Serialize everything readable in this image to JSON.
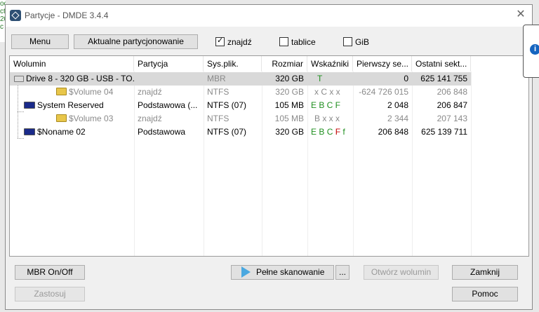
{
  "window": {
    "title": "Partycje - DMDE 3.4.4",
    "close_glyph": "✕"
  },
  "toolbar": {
    "menu": "Menu",
    "partitioning": "Aktualne partycjonowanie",
    "found": {
      "label": "znajdź",
      "checked": true
    },
    "tables": {
      "label": "tablice",
      "checked": false
    },
    "gib": {
      "label": "GiB",
      "checked": false
    }
  },
  "table": {
    "columns": [
      "Wolumin",
      "Partycja",
      "Sys.plik.",
      "Rozmiar",
      "Wskaźniki",
      "Pierwszy se...",
      "Ostatni sekt..."
    ],
    "rows": [
      {
        "name": "Drive 8 - 320 GB - USB - TO...",
        "partition": "",
        "fs": "MBR",
        "size": "320 GB",
        "flags": "T",
        "first": "0",
        "last": "625 141 755"
      },
      {
        "name": "$Volume 04",
        "partition": "znajdź",
        "fs": "NTFS",
        "size": "320 GB",
        "flags": "x C x x",
        "first": "-624 726 015",
        "last": "206 848"
      },
      {
        "name": "System Reserved",
        "partition": "Podstawowa (...",
        "fs": "NTFS (07)",
        "size": "105 MB",
        "flags": "E B C F",
        "first": "2 048",
        "last": "206 847"
      },
      {
        "name": "$Volume 03",
        "partition": "znajdź",
        "fs": "NTFS",
        "size": "105 MB",
        "flags": "B x x x",
        "first": "2 344",
        "last": "207 143"
      },
      {
        "name": "$Noname 02",
        "partition": "Podstawowa",
        "fs": "NTFS (07)",
        "size": "320 GB",
        "flags": "E B C F f",
        "first": "206 848",
        "last": "625 139 711"
      }
    ]
  },
  "buttons": {
    "mbr": "MBR On/Off",
    "apply": "Zastosuj",
    "full_scan": "Pełne skanowanie",
    "more": "...",
    "open_volume": "Otwórz wolumin",
    "close": "Zamknij",
    "help": "Pomoc"
  },
  "colors": {
    "flag_green": "#1f8f1f",
    "flag_red": "#c00000",
    "selection": "#d9d9d9",
    "scan_icon": "#4aa8e0"
  }
}
